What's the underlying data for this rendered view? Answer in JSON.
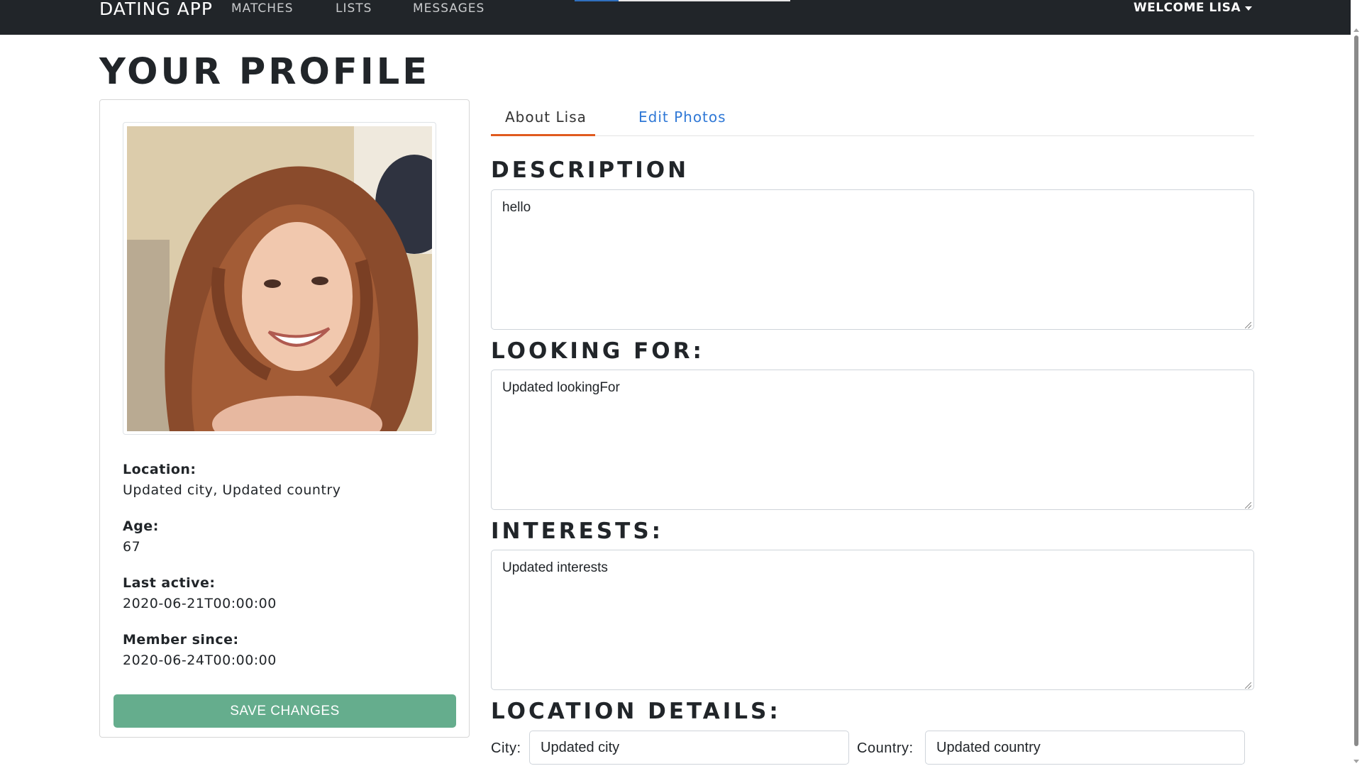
{
  "navbar": {
    "brand": "DATING APP",
    "links": [
      "MATCHES",
      "LISTS",
      "MESSAGES"
    ],
    "welcome": "WELCOME LISA"
  },
  "page": {
    "title": "YOUR PROFILE"
  },
  "profile": {
    "location_label": "Location:",
    "location_value": "Updated city, Updated country",
    "age_label": "Age:",
    "age_value": "67",
    "last_active_label": "Last active:",
    "last_active_value": "2020-06-21T00:00:00",
    "member_since_label": "Member since:",
    "member_since_value": "2020-06-24T00:00:00",
    "save_label": "SAVE CHANGES"
  },
  "tabs": {
    "about": "About Lisa",
    "edit_photos": "Edit Photos"
  },
  "form": {
    "description_heading": "DESCRIPTION",
    "description_value": "hello",
    "looking_for_heading": "LOOKING FOR:",
    "looking_for_value": "Updated lookingFor",
    "interests_heading": "INTERESTS:",
    "interests_value": "Updated interests",
    "location_heading": "LOCATION DETAILS:",
    "city_label": "City:",
    "city_value": "Updated city",
    "country_label": "Country:",
    "country_value": "Updated country"
  },
  "colors": {
    "navbar": "#212529",
    "save_button": "#65ad8d",
    "active_tab_accent": "#e05a1f",
    "link_blue": "#2f78d6"
  }
}
